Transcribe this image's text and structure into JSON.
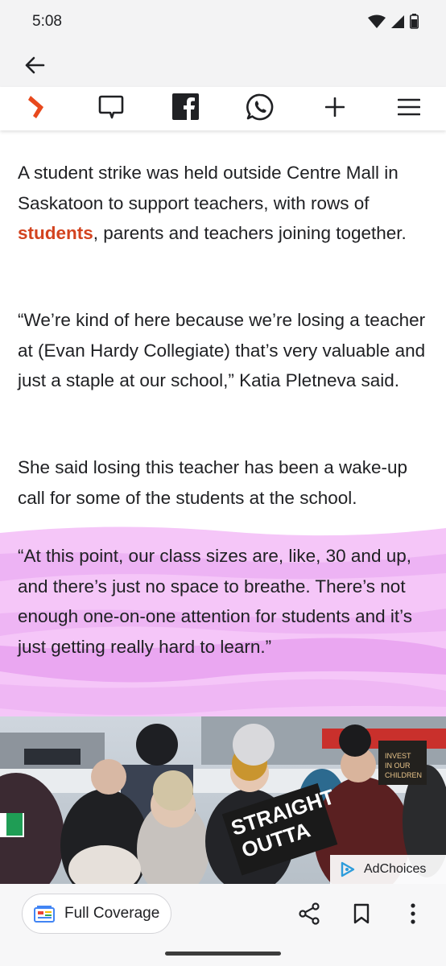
{
  "status_bar": {
    "time": "5:08",
    "icons": [
      "wifi-icon",
      "cell-signal-icon",
      "battery-icon"
    ]
  },
  "app_bar": {
    "back_icon": "arrow-back-icon"
  },
  "toolbar": {
    "icons": [
      "site-logo-icon",
      "comment-icon",
      "facebook-icon",
      "whatsapp-icon",
      "plus-icon",
      "menu-icon"
    ],
    "brand_color": "#e8491d"
  },
  "article": {
    "p1_before": "A student strike was held outside Centre Mall in Saskatoon to support teachers, with rows of ",
    "p1_link": "students",
    "p1_after": ", parents and teachers joining together.",
    "p2": "“We’re kind of here because we’re losing a teacher at (Evan Hardy Collegiate) that’s very valuable and just a staple at our school,” Katia Pletneva said.",
    "p3": "She said losing this teacher has been a wake-up call for some of the students at the school.",
    "p4": "“At this point, our class sizes are, like, 30 and up, and there’s just no space to breathe. There’s not enough one-on-one attention for students and it’s just getting really hard to learn.”",
    "link_color": "#d3431f",
    "highlight_color": "#f0b3f5"
  },
  "ad": {
    "adchoices_label": "AdChoices",
    "sign_text_1": "STRAIGHT",
    "sign_text_2": "OUTTA",
    "sign_small_1": "INVEST",
    "sign_small_2": "IN OUR",
    "sign_small_3": "CHILDREN"
  },
  "bottom_bar": {
    "full_coverage_label": "Full Coverage",
    "icons": [
      "share-icon",
      "bookmark-icon",
      "more-vert-icon"
    ]
  }
}
